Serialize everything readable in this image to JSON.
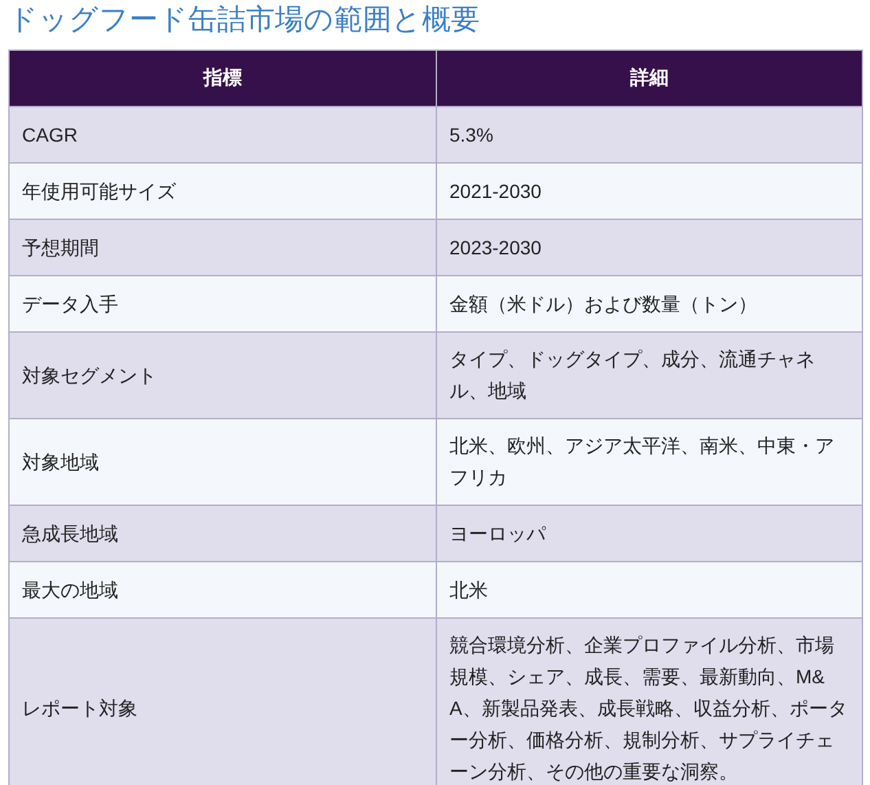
{
  "title": "ドッグフード缶詰市場の範囲と概要",
  "table": {
    "columns": [
      "指標",
      "詳細"
    ],
    "rows": [
      {
        "label": "CAGR",
        "value": "5.3%"
      },
      {
        "label": "年使用可能サイズ",
        "value": "2021-2030"
      },
      {
        "label": "予想期間",
        "value": "2023-2030"
      },
      {
        "label": "データ入手",
        "value": "金額（米ドル）および数量（トン）"
      },
      {
        "label": "対象セグメント",
        "value": "タイプ、ドッグタイプ、成分、流通チャネル、地域"
      },
      {
        "label": "対象地域",
        "value": "北米、欧州、アジア太平洋、南米、中東・アフリカ"
      },
      {
        "label": "急成長地域",
        "value": "ヨーロッパ"
      },
      {
        "label": "最大の地域",
        "value": "北米"
      },
      {
        "label": "レポート対象",
        "value": "競合環境分析、企業プロファイル分析、市場規模、シェア、成長、需要、最新動向、M&A、新製品発表、成長戦略、収益分析、ポーター分析、価格分析、規制分析、サプライチェーン分析、その他の重要な洞察。"
      }
    ]
  }
}
